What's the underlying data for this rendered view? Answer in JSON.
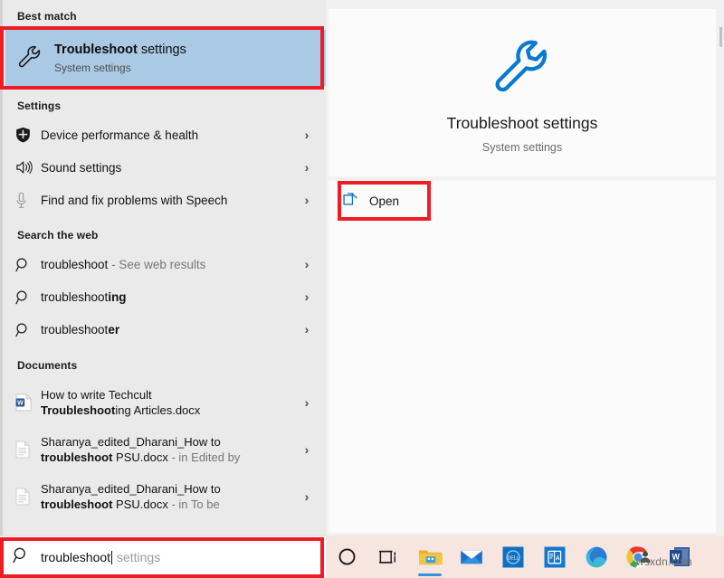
{
  "search": {
    "typed_text": "troubleshoot",
    "suggestion_text": " settings",
    "icon": "search-icon"
  },
  "results": {
    "best_match": {
      "header": "Best match",
      "title_bold": "Troubleshoot",
      "title_rest": " settings",
      "subtitle": "System settings",
      "icon": "wrench-icon"
    },
    "settings": {
      "header": "Settings",
      "items": [
        {
          "label": "Device performance & health",
          "icon": "shield-icon",
          "chevron": "›"
        },
        {
          "label": "Sound settings",
          "icon": "speaker-icon",
          "chevron": "›"
        },
        {
          "label": "Find and fix problems with Speech",
          "icon": "microphone-icon",
          "chevron": "›"
        }
      ]
    },
    "web": {
      "header": "Search the web",
      "items": [
        {
          "bold_part": "",
          "normal_part": "troubleshoot",
          "suffix_dim": " - See web results",
          "icon": "search-icon",
          "chevron": "›"
        },
        {
          "bold_part": "ing",
          "normal_part": "troubleshoot",
          "suffix_dim": "",
          "icon": "search-icon",
          "chevron": "›"
        },
        {
          "bold_part": "er",
          "normal_part": "troubleshoot",
          "suffix_dim": "",
          "icon": "search-icon",
          "chevron": "›"
        }
      ]
    },
    "documents": {
      "header": "Documents",
      "items": [
        {
          "line1": "How to write Techcult",
          "line2_bold": "Troubleshoot",
          "line2_rest": "ing Articles.docx",
          "line2_dim": "",
          "icon": "word-document-icon",
          "chevron": "›"
        },
        {
          "line1": "Sharanya_edited_Dharani_How to",
          "line2_bold": "troubleshoot",
          "line2_rest": " PSU.docx",
          "line2_dim": " - in Edited by",
          "icon": "generic-document-icon",
          "chevron": "›"
        },
        {
          "line1": "Sharanya_edited_Dharani_How to",
          "line2_bold": "troubleshoot",
          "line2_rest": " PSU.docx",
          "line2_dim": " - in To be",
          "icon": "generic-document-icon",
          "chevron": "›"
        }
      ]
    }
  },
  "preview": {
    "icon": "wrench-icon",
    "title": "Troubleshoot settings",
    "subtitle": "System settings",
    "open_label": "Open",
    "open_icon": "open-in-new-icon"
  },
  "taskbar": {
    "items": [
      {
        "name": "cortana-circle-icon",
        "label": "Cortana"
      },
      {
        "name": "task-view-icon",
        "label": "Task View"
      },
      {
        "name": "file-explorer-icon",
        "label": "File Explorer"
      },
      {
        "name": "mail-icon",
        "label": "Mail"
      },
      {
        "name": "dell-icon",
        "label": "Dell"
      },
      {
        "name": "dictionary-app-icon",
        "label": "Dictionary"
      },
      {
        "name": "microsoft-edge-icon",
        "label": "Microsoft Edge"
      },
      {
        "name": "google-chrome-icon",
        "label": "Google Chrome"
      },
      {
        "name": "microsoft-word-icon",
        "label": "Microsoft Word"
      }
    ]
  },
  "watermark": {
    "text": "wsxdn.com"
  },
  "colors": {
    "highlight": "#aac9e5",
    "annotation_red": "#ee1c25",
    "accent_blue": "#0a7ad1",
    "left_panel": "#eaeaea",
    "right_panel": "#fbfbfb",
    "taskbar": "#f6e6df"
  }
}
